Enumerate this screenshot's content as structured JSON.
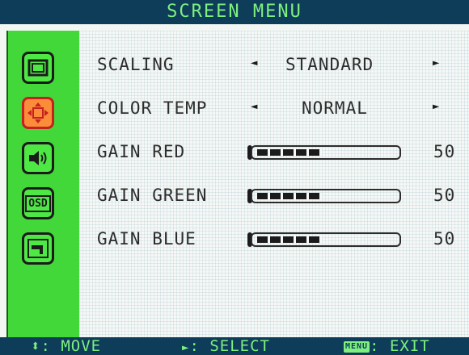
{
  "title": "SCREEN MENU",
  "sidebar": {
    "items": [
      {
        "icon": "display-icon",
        "active": false
      },
      {
        "icon": "position-icon",
        "active": true
      },
      {
        "icon": "speaker-icon",
        "active": false
      },
      {
        "icon": "osd-icon",
        "active": false
      },
      {
        "icon": "tools-icon",
        "active": false
      }
    ],
    "osd_label": "OSD"
  },
  "menu": {
    "scaling": {
      "label": "SCALING",
      "value": "STANDARD"
    },
    "color_temp": {
      "label": "COLOR TEMP",
      "value": "NORMAL"
    },
    "gain_red": {
      "label": "GAIN RED",
      "value": "50"
    },
    "gain_green": {
      "label": "GAIN GREEN",
      "value": "50"
    },
    "gain_blue": {
      "label": "GAIN BLUE",
      "value": "50"
    }
  },
  "arrows": {
    "left": "◄",
    "right": "►"
  },
  "footer": {
    "move": ": MOVE",
    "select": ": SELECT",
    "menu_chip": "MENU",
    "exit": ": EXIT",
    "move_icon": "⬍",
    "select_icon": "►"
  },
  "colors": {
    "accent": "#7ff07f",
    "sidebar": "#43d83a",
    "active": "#fb8c3a"
  }
}
